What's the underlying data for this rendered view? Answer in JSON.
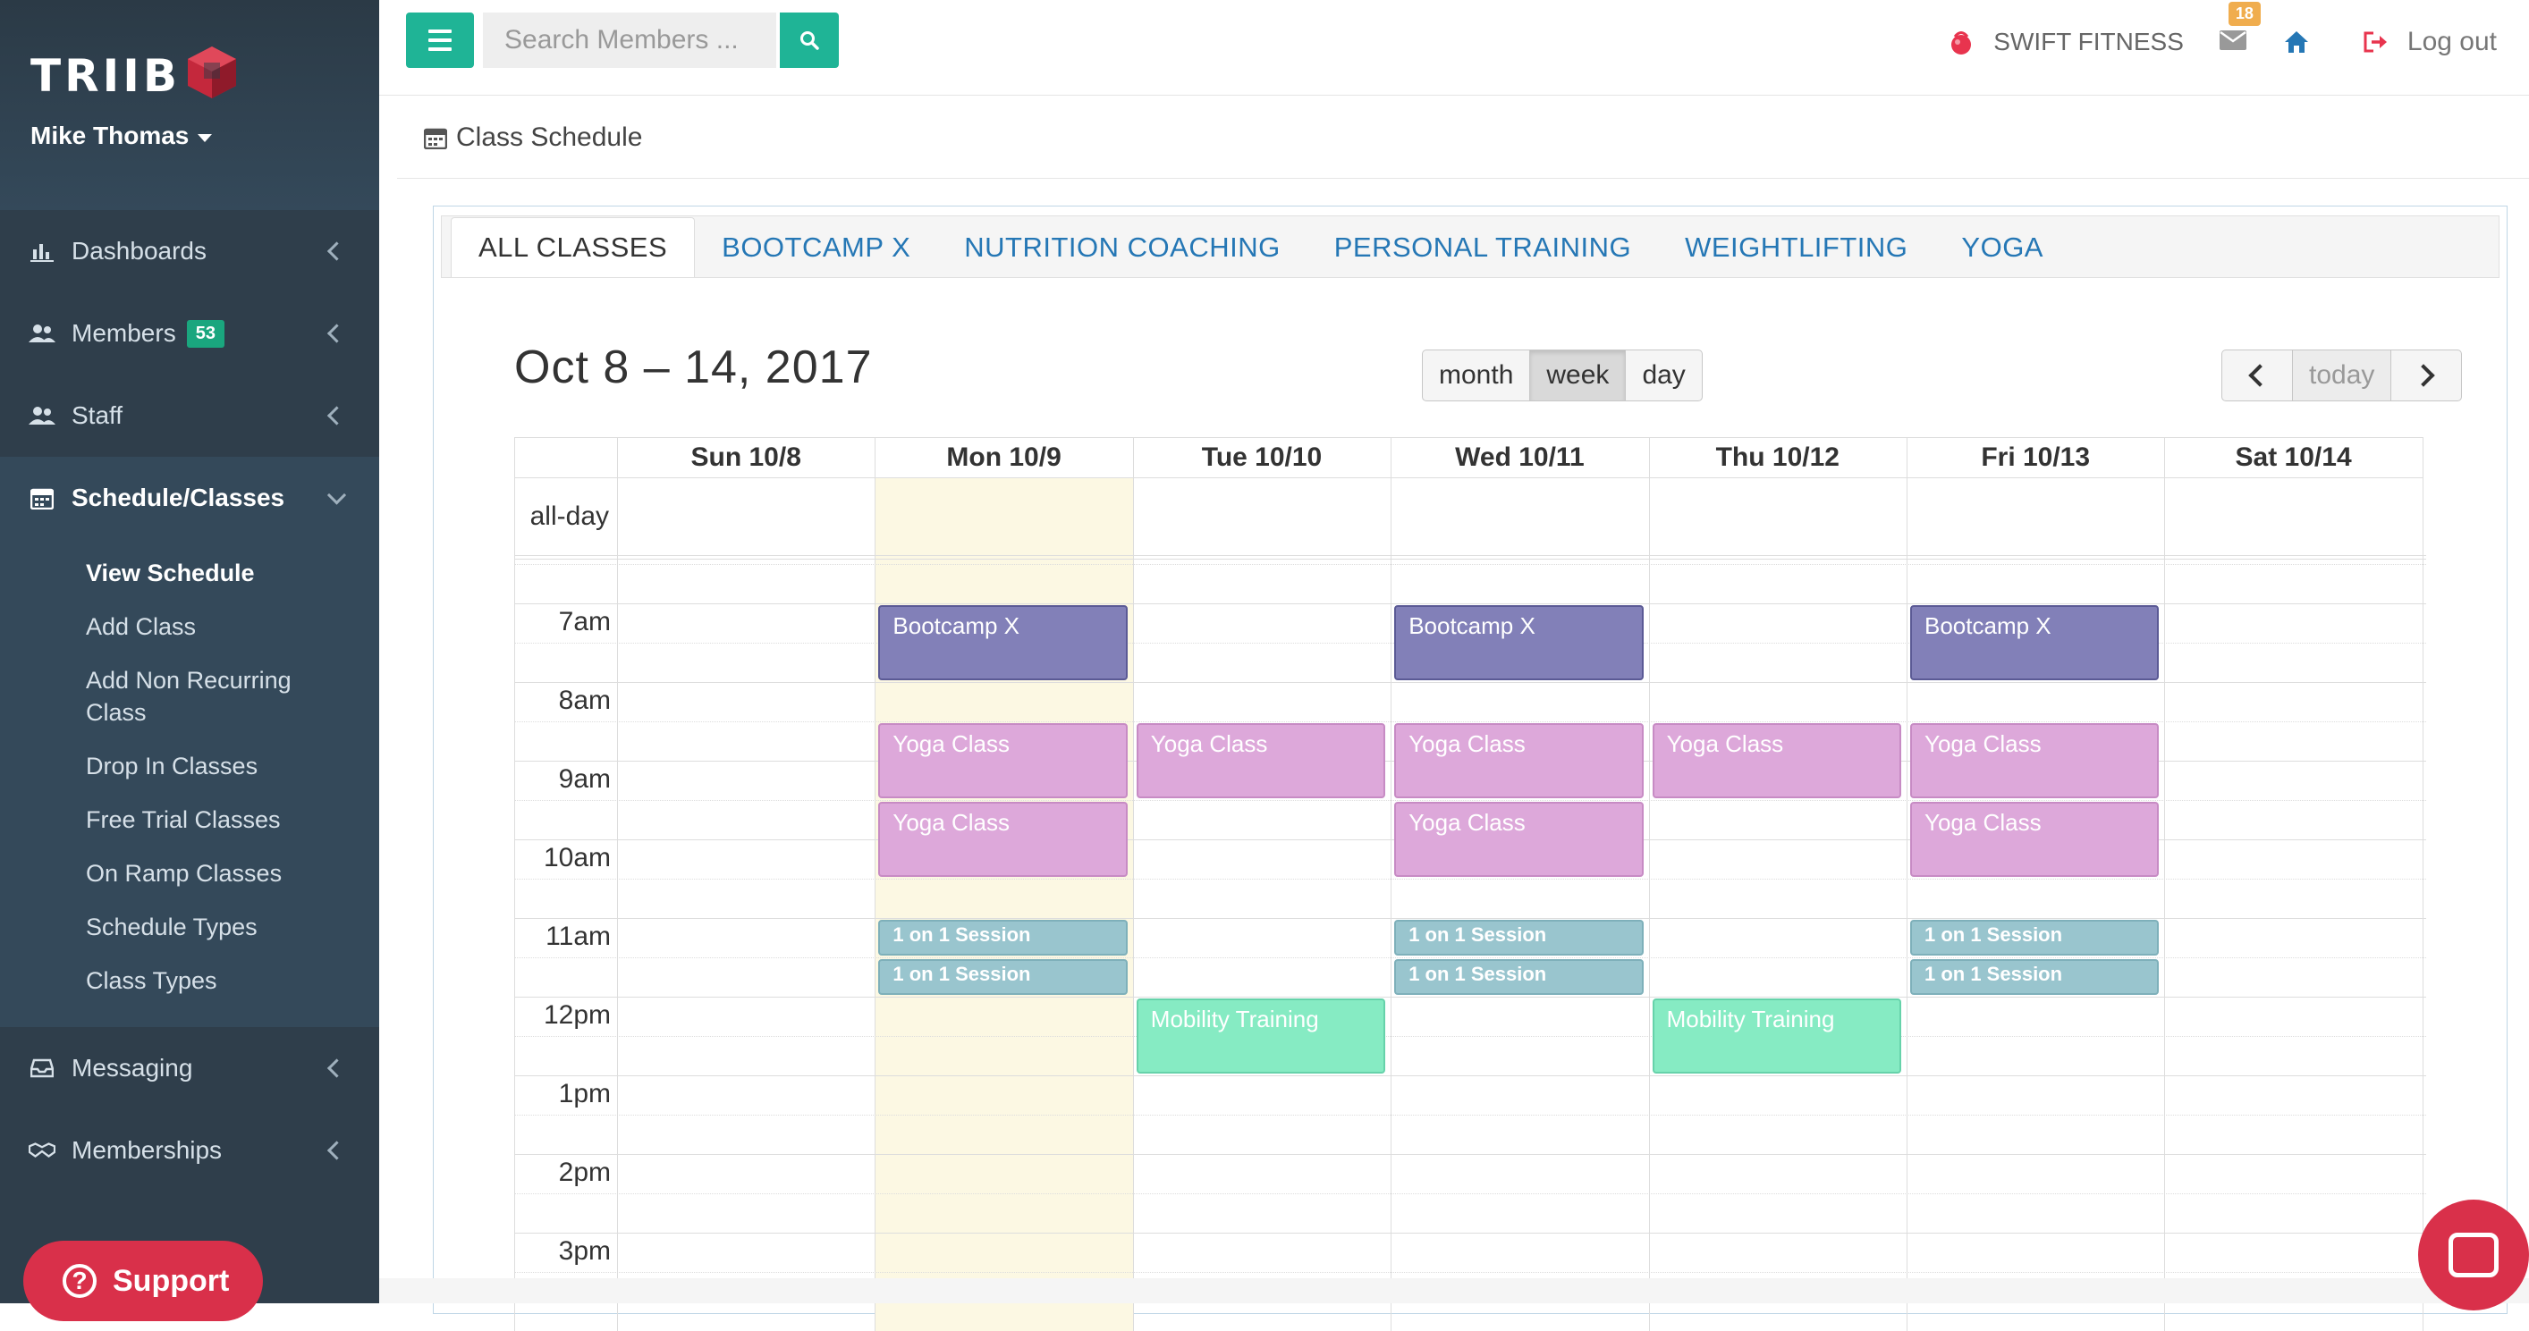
{
  "brand": {
    "logo_text": "TRIIB",
    "user_name": "Mike Thomas",
    "colors": {
      "sidebar": "#2f3e4b",
      "accent": "#1fb496",
      "danger": "#d9304a",
      "link": "#2577b5"
    }
  },
  "sidebar": {
    "items": [
      {
        "label": "Dashboards",
        "icon": "bar-chart-icon"
      },
      {
        "label": "Members",
        "icon": "users-icon",
        "badge": "53"
      },
      {
        "label": "Staff",
        "icon": "users-icon"
      },
      {
        "label": "Schedule/Classes",
        "icon": "calendar-icon"
      },
      {
        "label": "Messaging",
        "icon": "inbox-icon"
      },
      {
        "label": "Memberships",
        "icon": "handshake-icon"
      }
    ],
    "schedule_sub": [
      "View Schedule",
      "Add Class",
      "Add Non Recurring Class",
      "Drop In Classes",
      "Free Trial Classes",
      "On Ramp Classes",
      "Schedule Types",
      "Class Types"
    ],
    "support_label": "Support"
  },
  "header": {
    "search_placeholder": "Search Members ...",
    "gym_name": "SWIFT FITNESS",
    "mail_count": "18",
    "logout_label": "Log out"
  },
  "page": {
    "title": "Class Schedule"
  },
  "tabs": [
    "ALL CLASSES",
    "BOOTCAMP X",
    "NUTRITION COACHING",
    "PERSONAL TRAINING",
    "WEIGHTLIFTING",
    "YOGA"
  ],
  "calendar": {
    "range_title": "Oct 8 – 14, 2017",
    "views": [
      "month",
      "week",
      "day"
    ],
    "active_view": "week",
    "today_label": "today",
    "all_day_label": "all-day",
    "days": [
      "Sun 10/8",
      "Mon 10/9",
      "Tue 10/10",
      "Wed 10/11",
      "Thu 10/12",
      "Fri 10/13",
      "Sat 10/14"
    ],
    "today_index": 1,
    "hours": [
      "7am",
      "8am",
      "9am",
      "10am",
      "11am",
      "12pm",
      "1pm",
      "2pm",
      "3pm"
    ],
    "events": [
      {
        "day": 1,
        "title": "Bootcamp X",
        "type": "boot",
        "start": 7.0,
        "end": 8.0
      },
      {
        "day": 3,
        "title": "Bootcamp X",
        "type": "boot",
        "start": 7.0,
        "end": 8.0
      },
      {
        "day": 5,
        "title": "Bootcamp X",
        "type": "boot",
        "start": 7.0,
        "end": 8.0
      },
      {
        "day": 1,
        "title": "Yoga Class",
        "type": "yoga",
        "start": 8.5,
        "end": 9.5
      },
      {
        "day": 2,
        "title": "Yoga Class",
        "type": "yoga",
        "start": 8.5,
        "end": 9.5
      },
      {
        "day": 3,
        "title": "Yoga Class",
        "type": "yoga",
        "start": 8.5,
        "end": 9.5
      },
      {
        "day": 4,
        "title": "Yoga Class",
        "type": "yoga",
        "start": 8.5,
        "end": 9.5
      },
      {
        "day": 5,
        "title": "Yoga Class",
        "type": "yoga",
        "start": 8.5,
        "end": 9.5
      },
      {
        "day": 1,
        "title": "Yoga Class",
        "type": "yoga",
        "start": 9.5,
        "end": 10.5
      },
      {
        "day": 3,
        "title": "Yoga Class",
        "type": "yoga",
        "start": 9.5,
        "end": 10.5
      },
      {
        "day": 5,
        "title": "Yoga Class",
        "type": "yoga",
        "start": 9.5,
        "end": 10.5
      },
      {
        "day": 1,
        "title": "1 on 1 Session",
        "type": "one",
        "start": 11.0,
        "end": 11.5
      },
      {
        "day": 3,
        "title": "1 on 1 Session",
        "type": "one",
        "start": 11.0,
        "end": 11.5
      },
      {
        "day": 5,
        "title": "1 on 1 Session",
        "type": "one",
        "start": 11.0,
        "end": 11.5
      },
      {
        "day": 1,
        "title": "1 on 1 Session",
        "type": "one",
        "start": 11.5,
        "end": 12.0
      },
      {
        "day": 3,
        "title": "1 on 1 Session",
        "type": "one",
        "start": 11.5,
        "end": 12.0
      },
      {
        "day": 5,
        "title": "1 on 1 Session",
        "type": "one",
        "start": 11.5,
        "end": 12.0
      },
      {
        "day": 2,
        "title": "Mobility Training",
        "type": "mob",
        "start": 12.0,
        "end": 13.0
      },
      {
        "day": 4,
        "title": "Mobility Training",
        "type": "mob",
        "start": 12.0,
        "end": 13.0
      }
    ]
  }
}
